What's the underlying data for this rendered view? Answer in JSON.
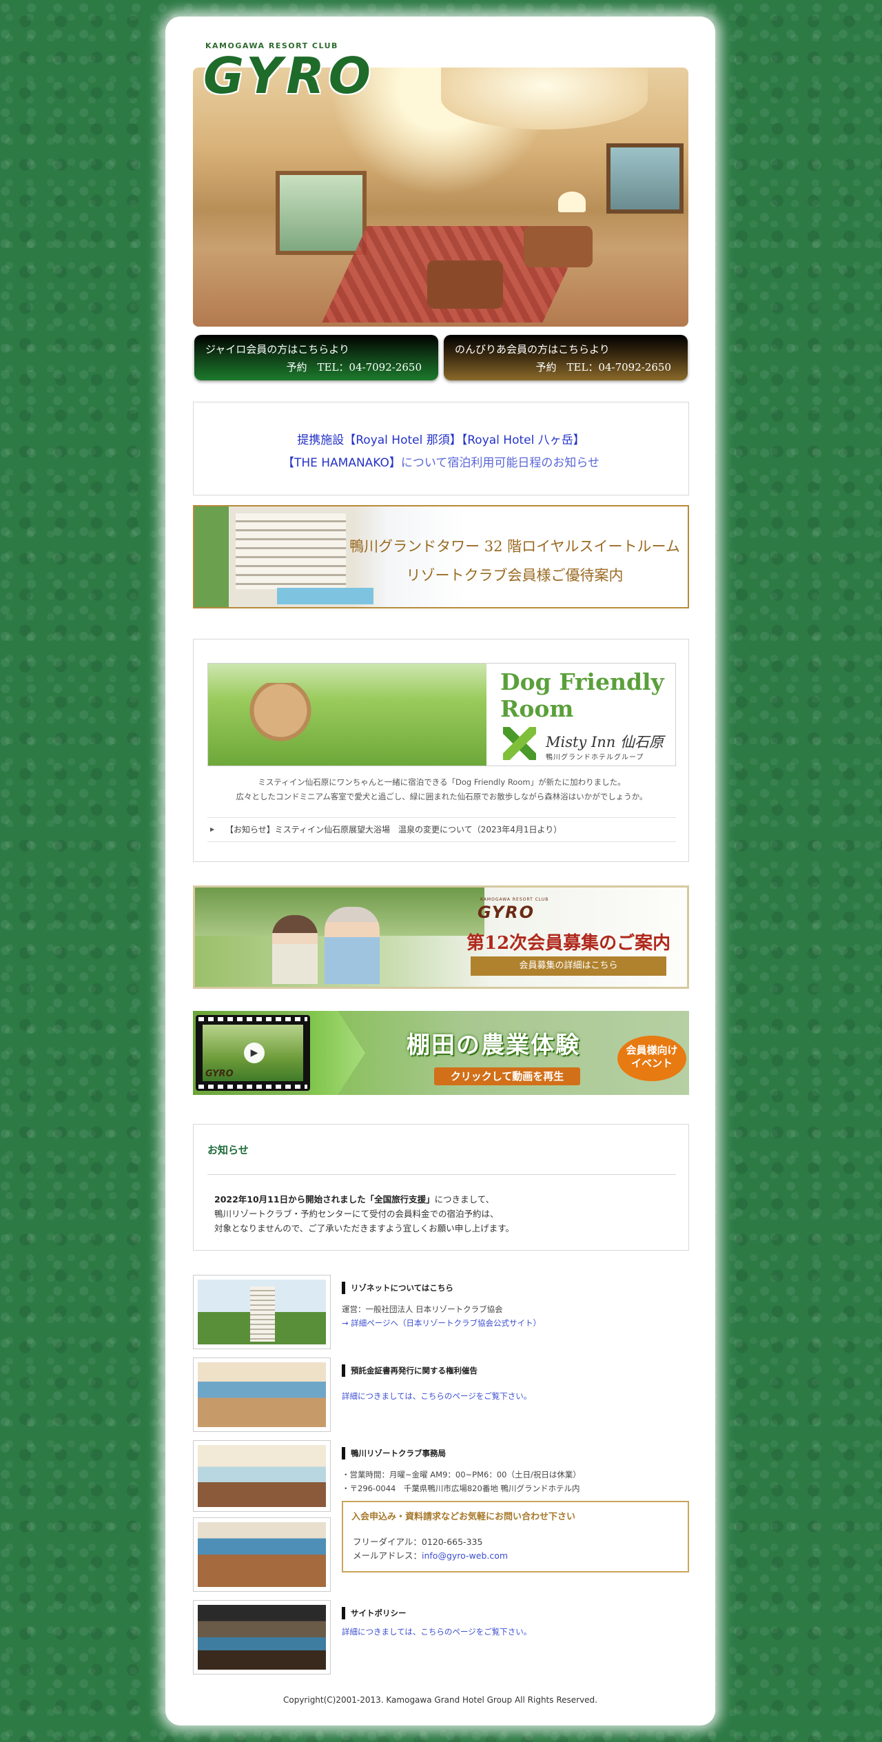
{
  "header": {
    "logo_sub": "KAMOGAWA RESORT CLUB",
    "logo_main": "GYRO"
  },
  "reserve": {
    "gyro": {
      "label": "ジャイロ会員の方はこちらより",
      "tel": "予約　TEL：04-7092-2650"
    },
    "nonbiri": {
      "label": "のんびりあ会員の方はこちらより",
      "tel": "予約　TEL：04-7092-2650"
    }
  },
  "partner_notice": {
    "line1": "提携施設【Royal Hotel 那須】【Royal Hotel 八ヶ岳】",
    "line2_a": "【THE HAMANAKO】",
    "line2_b": "について宿泊利用可能日程のお知らせ"
  },
  "tower_banner": {
    "line1": "鴨川グランドタワー 32 階ロイヤルスイートルーム",
    "line2": "リゾートクラブ会員様ご優待案内"
  },
  "dog": {
    "title_line1": "Dog Friendly",
    "title_line2": "Room",
    "hotel": "Misty Inn 仙石原",
    "group": "鴨川グランドホテルグループ",
    "desc1": "ミスティイン仙石原にワンちゃんと一緒に宿泊できる「Dog Friendly Room」が新たに加わりました。",
    "desc2": "広々としたコンドミニアム客室で愛犬と過ごし、緑に囲まれた仙石原でお散歩しながら森林浴はいかがでしょうか。",
    "news": "【お知らせ】ミスティイン仙石原展望大浴場　温泉の変更について（2023年4月1日より）"
  },
  "recruit": {
    "logo_sub": "KAMOGAWA RESORT CLUB",
    "logo": "GYRO",
    "headline": "第12次会員募集のご案内",
    "button": "会員募集の詳細はこちら"
  },
  "tanada": {
    "logo": "GYRO",
    "title": "棚田の農業体験",
    "sub": "クリックして動画を再生",
    "badge_line1": "会員様向け",
    "badge_line2": "イベント"
  },
  "notice": {
    "title": "お知らせ",
    "line1_bold": "2022年10月11日から開始されました「全国旅行支援」",
    "line1_rest": "につきまして、",
    "line2": "鴨川リゾートクラブ・予約センターにて受付の会員料金での宿泊予約は、",
    "line3": "対象となりませんので、ご了承いただきますよう宜しくお願い申し上げます。"
  },
  "resonet": {
    "head": "リゾネットについてはこちら",
    "org": "運営：一般社団法人 日本リゾートクラブ協会",
    "link": "→ 詳細ページへ（日本リゾートクラブ協会公式サイト）"
  },
  "deposit": {
    "head": "預託金証書再発行に関する権利催告",
    "link": "詳細につきましては、こちらのページをご覧下さい。"
  },
  "office": {
    "head": "鴨川リゾートクラブ事務局",
    "hours": "・営業時間：月曜~金曜 AM9：00~PM6：00（土日/祝日は休業）",
    "address": "・〒296-0044　千葉県鴨川市広場820番地 鴨川グランドホテル内"
  },
  "contact": {
    "title": "入会申込み・資料請求などお気軽にお問い合わせ下さい",
    "freedial": "フリーダイアル：0120-665-335",
    "mail_label": "メールアドレス：",
    "mail": "info@gyro-web.com"
  },
  "policy": {
    "head": "サイトポリシー",
    "link": "詳細につきましては、こちらのページをご覧下さい。"
  },
  "footer": {
    "copyright": "Copyright(C)2001-2013. Kamogawa Grand Hotel Group All Rights Reserved."
  }
}
